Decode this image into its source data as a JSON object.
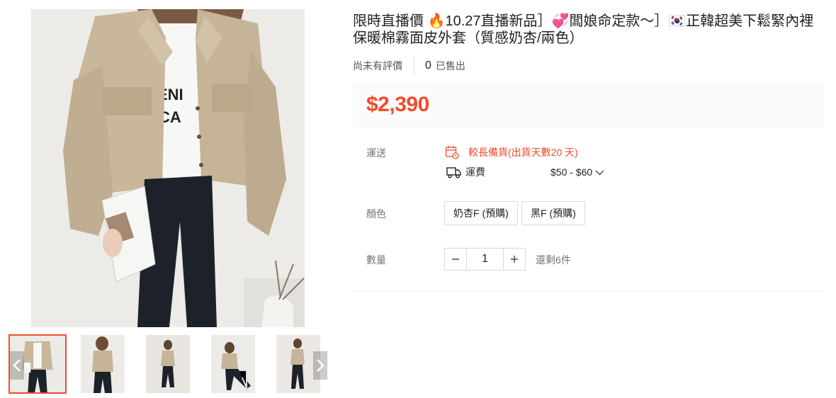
{
  "product": {
    "title": "限時直播價 🔥10.27直播新品］💞闆娘命定款〜］🇰🇷正韓超美下鬆緊內裡保暖棉霧面皮外套（質感奶杏/兩色）",
    "rating_text": "尚未有評價",
    "sold_count": "0",
    "sold_label": "已售出",
    "price": "$2,390"
  },
  "shipping": {
    "label": "運送",
    "note": "較長備貨(出貨天數20 天)",
    "fee_label": "運費",
    "fee_value": "$50 - $60"
  },
  "color": {
    "label": "顏色",
    "options": [
      "奶杏F (預購)",
      "黑F (預購)"
    ]
  },
  "quantity": {
    "label": "數量",
    "value": "1",
    "stock_text": "還剩6件"
  },
  "gallery": {
    "thumbnail_count": 5,
    "active_index": 0
  },
  "colors": {
    "accent": "#ee4d2d",
    "price_bg": "#fafafa",
    "border": "#d9d9d9",
    "muted_text": "#757575"
  },
  "icons": [
    "chevron-left-icon",
    "chevron-right-icon",
    "calendar-icon",
    "truck-icon",
    "chevron-down-icon",
    "minus-icon",
    "plus-icon"
  ]
}
